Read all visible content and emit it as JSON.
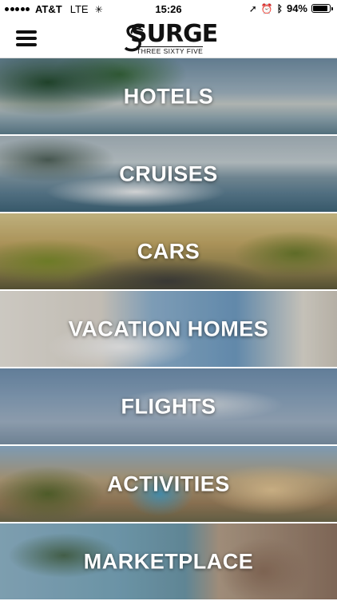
{
  "status_bar": {
    "carrier": "AT&T",
    "network": "LTE",
    "time": "15:26",
    "battery_percent": "94%",
    "battery_level": 0.94,
    "icons": [
      "signal-dots-icon",
      "activity-spinner-icon",
      "location-arrow-icon",
      "alarm-clock-icon",
      "bluetooth-icon",
      "battery-icon"
    ]
  },
  "header": {
    "menu_icon": "hamburger-menu-icon",
    "logo_main": "SURGE",
    "logo_sub": "THREE SIXTY FIVE"
  },
  "tiles": [
    {
      "label": "HOTELS"
    },
    {
      "label": "CRUISES"
    },
    {
      "label": "CARS"
    },
    {
      "label": "VACATION HOMES"
    },
    {
      "label": "FLIGHTS"
    },
    {
      "label": "ACTIVITIES"
    },
    {
      "label": "MARKETPLACE"
    }
  ],
  "colors": {
    "tile_text": "#ffffff",
    "header_bg": "#ffffff"
  }
}
